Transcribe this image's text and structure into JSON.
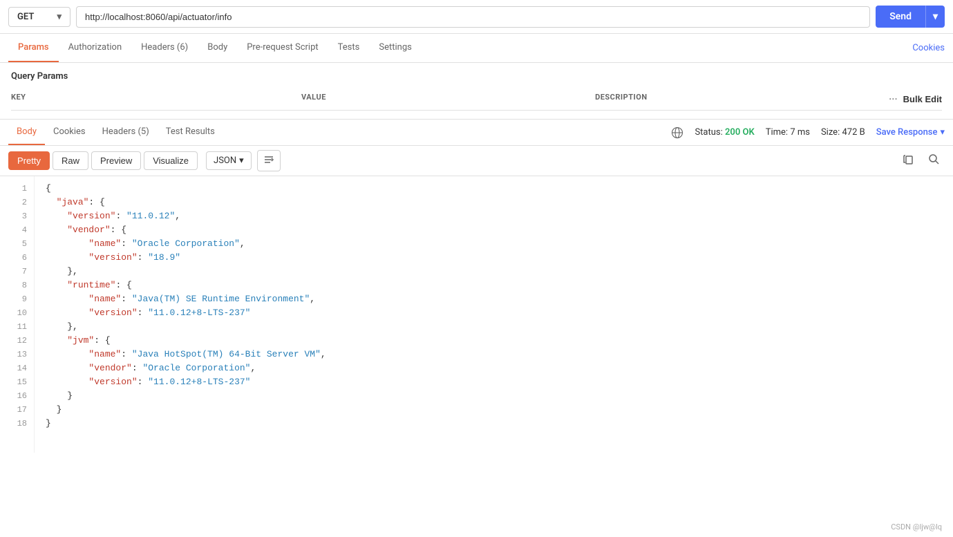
{
  "urlBar": {
    "method": "GET",
    "url": "http://localhost:8060/api/actuator/info",
    "sendLabel": "Send"
  },
  "requestTabs": {
    "tabs": [
      {
        "id": "params",
        "label": "Params",
        "active": true
      },
      {
        "id": "authorization",
        "label": "Authorization",
        "active": false
      },
      {
        "id": "headers",
        "label": "Headers (6)",
        "active": false
      },
      {
        "id": "body",
        "label": "Body",
        "active": false
      },
      {
        "id": "prerequest",
        "label": "Pre-request Script",
        "active": false
      },
      {
        "id": "tests",
        "label": "Tests",
        "active": false
      },
      {
        "id": "settings",
        "label": "Settings",
        "active": false
      }
    ],
    "cookiesLabel": "Cookies"
  },
  "queryParams": {
    "title": "Query Params",
    "columns": {
      "key": "KEY",
      "value": "VALUE",
      "description": "DESCRIPTION"
    },
    "bulkEditLabel": "Bulk Edit"
  },
  "responseTabs": {
    "tabs": [
      {
        "id": "body",
        "label": "Body",
        "active": true
      },
      {
        "id": "cookies",
        "label": "Cookies",
        "active": false
      },
      {
        "id": "headers",
        "label": "Headers (5)",
        "active": false
      },
      {
        "id": "testresults",
        "label": "Test Results",
        "active": false
      }
    ],
    "status": {
      "statusText": "200 OK",
      "timeLabel": "Time:",
      "timeValue": "7 ms",
      "sizeLabel": "Size:",
      "sizeValue": "472 B"
    },
    "saveResponseLabel": "Save Response"
  },
  "responseToolbar": {
    "viewButtons": [
      {
        "id": "pretty",
        "label": "Pretty",
        "active": true
      },
      {
        "id": "raw",
        "label": "Raw",
        "active": false
      },
      {
        "id": "preview",
        "label": "Preview",
        "active": false
      },
      {
        "id": "visualize",
        "label": "Visualize",
        "active": false
      }
    ],
    "format": "JSON"
  },
  "codeLines": [
    {
      "num": 1,
      "content": [
        {
          "type": "brace",
          "text": "{"
        }
      ]
    },
    {
      "num": 2,
      "content": [
        {
          "type": "indent2",
          "text": "  "
        },
        {
          "type": "key",
          "text": "\"java\""
        },
        {
          "type": "colon",
          "text": ": {"
        }
      ]
    },
    {
      "num": 3,
      "content": [
        {
          "type": "indent4",
          "text": "    "
        },
        {
          "type": "key",
          "text": "\"version\""
        },
        {
          "type": "colon",
          "text": ": "
        },
        {
          "type": "str",
          "text": "\"11.0.12\""
        },
        {
          "type": "comma",
          "text": ","
        }
      ]
    },
    {
      "num": 4,
      "content": [
        {
          "type": "indent4",
          "text": "    "
        },
        {
          "type": "key",
          "text": "\"vendor\""
        },
        {
          "type": "colon",
          "text": ": {"
        }
      ]
    },
    {
      "num": 5,
      "content": [
        {
          "type": "indent6",
          "text": "        "
        },
        {
          "type": "key",
          "text": "\"name\""
        },
        {
          "type": "colon",
          "text": ": "
        },
        {
          "type": "str",
          "text": "\"Oracle Corporation\""
        },
        {
          "type": "comma",
          "text": ","
        }
      ]
    },
    {
      "num": 6,
      "content": [
        {
          "type": "indent6",
          "text": "        "
        },
        {
          "type": "key",
          "text": "\"version\""
        },
        {
          "type": "colon",
          "text": ": "
        },
        {
          "type": "str",
          "text": "\"18.9\""
        }
      ]
    },
    {
      "num": 7,
      "content": [
        {
          "type": "indent4",
          "text": "    "
        },
        {
          "type": "brace",
          "text": "},"
        }
      ]
    },
    {
      "num": 8,
      "content": [
        {
          "type": "indent4",
          "text": "    "
        },
        {
          "type": "key",
          "text": "\"runtime\""
        },
        {
          "type": "colon",
          "text": ": {"
        }
      ]
    },
    {
      "num": 9,
      "content": [
        {
          "type": "indent6",
          "text": "        "
        },
        {
          "type": "key",
          "text": "\"name\""
        },
        {
          "type": "colon",
          "text": ": "
        },
        {
          "type": "str",
          "text": "\"Java(TM) SE Runtime Environment\""
        },
        {
          "type": "comma",
          "text": ","
        }
      ]
    },
    {
      "num": 10,
      "content": [
        {
          "type": "indent6",
          "text": "        "
        },
        {
          "type": "key",
          "text": "\"version\""
        },
        {
          "type": "colon",
          "text": ": "
        },
        {
          "type": "str",
          "text": "\"11.0.12+8-LTS-237\""
        }
      ]
    },
    {
      "num": 11,
      "content": [
        {
          "type": "indent4",
          "text": "    "
        },
        {
          "type": "brace",
          "text": "},"
        }
      ]
    },
    {
      "num": 12,
      "content": [
        {
          "type": "indent4",
          "text": "    "
        },
        {
          "type": "key",
          "text": "\"jvm\""
        },
        {
          "type": "colon",
          "text": ": {"
        }
      ]
    },
    {
      "num": 13,
      "content": [
        {
          "type": "indent6",
          "text": "        "
        },
        {
          "type": "key",
          "text": "\"name\""
        },
        {
          "type": "colon",
          "text": ": "
        },
        {
          "type": "str",
          "text": "\"Java HotSpot(TM) 64-Bit Server VM\""
        },
        {
          "type": "comma",
          "text": ","
        }
      ]
    },
    {
      "num": 14,
      "content": [
        {
          "type": "indent6",
          "text": "        "
        },
        {
          "type": "key",
          "text": "\"vendor\""
        },
        {
          "type": "colon",
          "text": ": "
        },
        {
          "type": "str",
          "text": "\"Oracle Corporation\""
        },
        {
          "type": "comma",
          "text": ","
        }
      ]
    },
    {
      "num": 15,
      "content": [
        {
          "type": "indent6",
          "text": "        "
        },
        {
          "type": "key",
          "text": "\"version\""
        },
        {
          "type": "colon",
          "text": ": "
        },
        {
          "type": "str",
          "text": "\"11.0.12+8-LTS-237\""
        }
      ]
    },
    {
      "num": 16,
      "content": [
        {
          "type": "indent4",
          "text": "    "
        },
        {
          "type": "brace",
          "text": "}"
        }
      ]
    },
    {
      "num": 17,
      "content": [
        {
          "type": "indent2",
          "text": "  "
        },
        {
          "type": "brace",
          "text": "}"
        }
      ]
    },
    {
      "num": 18,
      "content": [
        {
          "type": "brace",
          "text": "}"
        }
      ]
    }
  ],
  "credit": "CSDN @ljw@lq"
}
